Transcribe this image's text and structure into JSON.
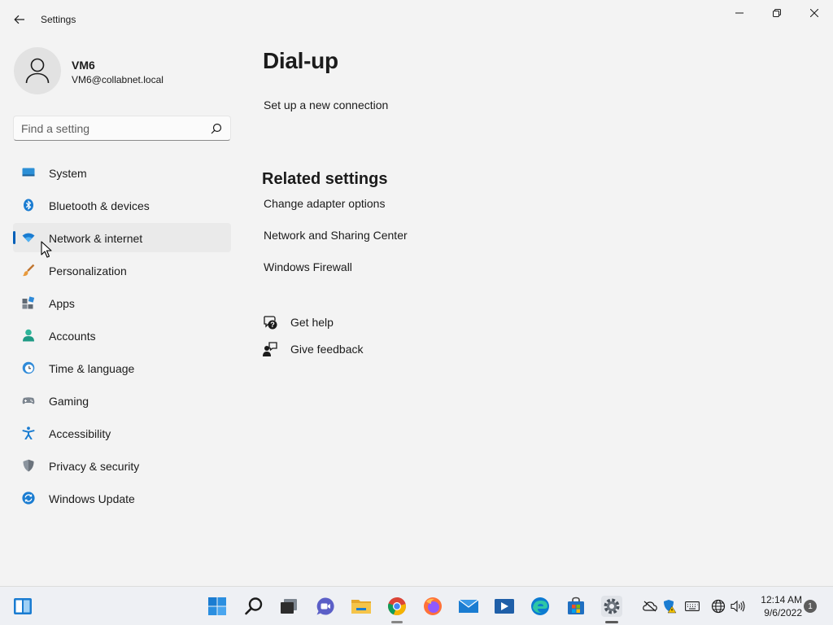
{
  "window": {
    "title": "Settings"
  },
  "user": {
    "name": "VM6",
    "email": "VM6@collabnet.local"
  },
  "search": {
    "placeholder": "Find a setting",
    "value": ""
  },
  "nav": {
    "items": [
      {
        "label": "System",
        "icon": "system-icon",
        "selected": false
      },
      {
        "label": "Bluetooth & devices",
        "icon": "bluetooth-icon",
        "selected": false
      },
      {
        "label": "Network & internet",
        "icon": "wifi-icon",
        "selected": true
      },
      {
        "label": "Personalization",
        "icon": "brush-icon",
        "selected": false
      },
      {
        "label": "Apps",
        "icon": "apps-icon",
        "selected": false
      },
      {
        "label": "Accounts",
        "icon": "person-icon",
        "selected": false
      },
      {
        "label": "Time & language",
        "icon": "clock-globe-icon",
        "selected": false
      },
      {
        "label": "Gaming",
        "icon": "gamepad-icon",
        "selected": false
      },
      {
        "label": "Accessibility",
        "icon": "accessibility-icon",
        "selected": false
      },
      {
        "label": "Privacy & security",
        "icon": "shield-icon",
        "selected": false
      },
      {
        "label": "Windows Update",
        "icon": "update-icon",
        "selected": false
      }
    ]
  },
  "main": {
    "title": "Dial-up",
    "setup_link": "Set up a new connection",
    "related_title": "Related settings",
    "related_links": [
      "Change adapter options",
      "Network and Sharing Center",
      "Windows Firewall"
    ],
    "get_help": "Get help",
    "give_feedback": "Give feedback"
  },
  "taskbar": {
    "apps": [
      "start-icon",
      "search-icon",
      "task-view-icon",
      "chat-icon",
      "file-explorer-icon",
      "chrome-icon",
      "firefox-icon",
      "mail-icon",
      "vm-icon",
      "edge-icon",
      "store-icon",
      "settings-icon"
    ],
    "tray": [
      "onedrive-icon",
      "security-icon",
      "keyboard-icon",
      "network-globe-icon",
      "volume-icon"
    ],
    "time": "12:14 AM",
    "date": "9/6/2022",
    "notification_count": "1"
  },
  "colors": {
    "accent": "#005fb8",
    "background": "#f3f3f3",
    "selected_nav": "#eaeaea"
  }
}
